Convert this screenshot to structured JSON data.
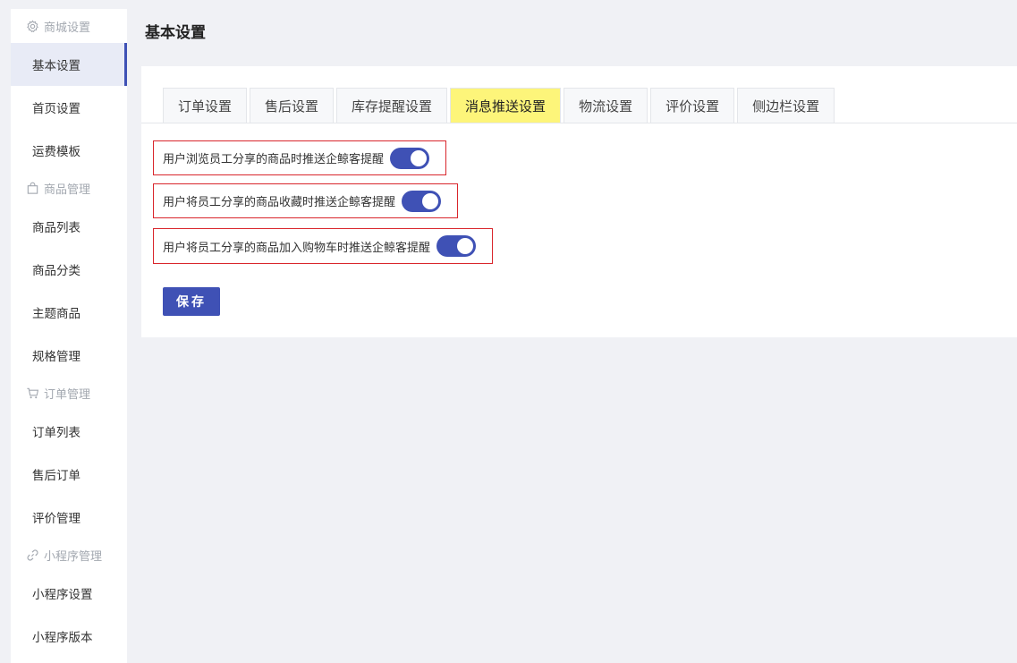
{
  "sidebar": {
    "groups": [
      {
        "title": "商城设置",
        "icon": "gear-icon",
        "items": [
          "基本设置",
          "首页设置",
          "运费模板"
        ]
      },
      {
        "title": "商品管理",
        "icon": "shopping-bag-icon",
        "items": [
          "商品列表",
          "商品分类",
          "主题商品",
          "规格管理"
        ]
      },
      {
        "title": "订单管理",
        "icon": "cart-icon",
        "items": [
          "订单列表",
          "售后订单",
          "评价管理"
        ]
      },
      {
        "title": "小程序管理",
        "icon": "link-icon",
        "items": [
          "小程序设置",
          "小程序版本"
        ]
      }
    ],
    "active_item": "基本设置"
  },
  "page": {
    "title": "基本设置"
  },
  "tabs": [
    "订单设置",
    "售后设置",
    "库存提醒设置",
    "消息推送设置",
    "物流设置",
    "评价设置",
    "侧边栏设置"
  ],
  "active_tab": "消息推送设置",
  "options": [
    {
      "label": "用户浏览员工分享的商品时推送企鲸客提醒",
      "enabled": true
    },
    {
      "label": "用户将员工分享的商品收藏时推送企鲸客提醒",
      "enabled": true
    },
    {
      "label": "用户将员工分享的商品加入购物车时推送企鲸客提醒",
      "enabled": true
    }
  ],
  "save_label": "保存",
  "colors": {
    "accent": "#3f51b5",
    "highlight_tab": "#fdf57a",
    "outline": "#d9262c"
  }
}
